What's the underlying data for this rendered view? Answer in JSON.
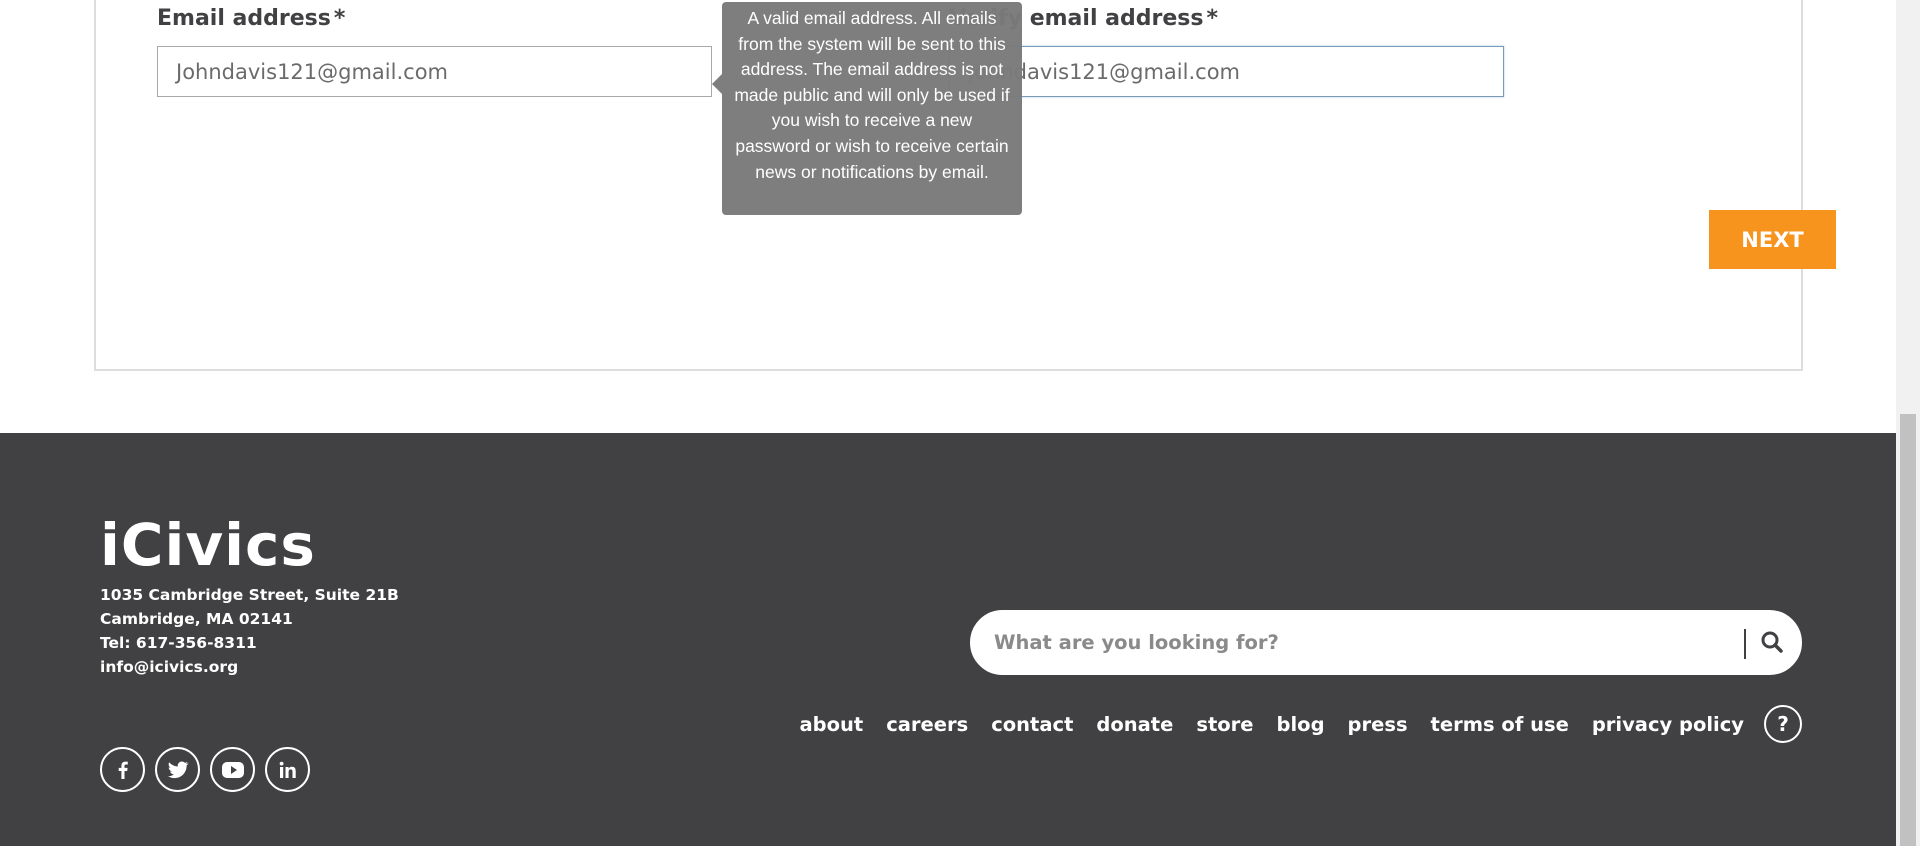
{
  "form": {
    "email_label": "Email address",
    "email_value": "Johndavis121@gmail.com",
    "verify_label": "Verify email address",
    "verify_value": "Johndavis121@gmail.com",
    "required_marker": "*",
    "next_label": "NEXT"
  },
  "tooltip": {
    "text": "A valid email address. All emails from the system will be sent to this address. The email address is not made public and will only be used if you wish to receive a new password or wish to receive certain news or notifications by email."
  },
  "footer": {
    "logo_text": "iCivics",
    "address": {
      "line1": "1035 Cambridge Street, Suite 21B",
      "line2": "Cambridge, MA 02141",
      "phone": "Tel: 617-356-8311",
      "email": "info@icivics.org"
    },
    "search": {
      "placeholder": "What are you looking for?"
    },
    "nav": [
      "about",
      "careers",
      "contact",
      "donate",
      "store",
      "blog",
      "press",
      "terms of use",
      "privacy policy"
    ],
    "help_label": "?",
    "social": [
      "facebook-icon",
      "twitter-icon",
      "youtube-icon",
      "linkedin-icon"
    ]
  },
  "colors": {
    "accent": "#f7941d",
    "footer_bg": "#414042",
    "tooltip_bg": "#7a7a7a"
  }
}
